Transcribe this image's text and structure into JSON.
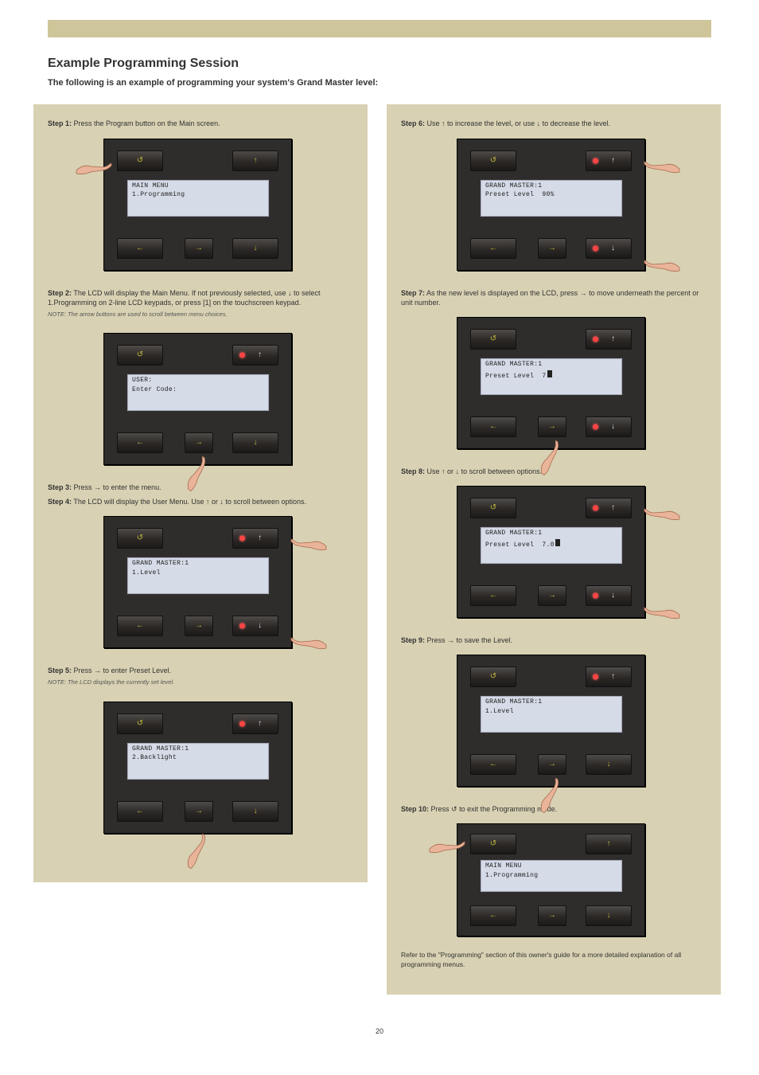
{
  "header": {
    "title": "Example Programming Session",
    "subtitle": "The following is an example of programming your system's Grand Master level:"
  },
  "left": {
    "s1": {
      "lab": "Step 1:",
      "txt": "Press the Program button on the Main screen."
    },
    "p1": {
      "l1": "MAIN MENU",
      "l2": "1.Programming"
    },
    "s2": {
      "lab": "Step 2:",
      "txt": "The LCD will display the Main Menu. If not previously selected, use ↓ to select 1.Programming on 2-line LCD keypads, or press [1] on the touchscreen keypad."
    },
    "n2": "NOTE: The arrow buttons are used to scroll between menu choices.",
    "p2": {
      "l1": "USER:",
      "l2": "Enter Code:"
    },
    "s3": {
      "lab": "Step 3:",
      "txt": "Press → to enter the menu."
    },
    "p3": {
      "l1": "GRAND MASTER:1",
      "l2": "1.Level"
    },
    "s4": {
      "lab": "Step 4:",
      "txt": "The LCD will display the User Menu. Use ↑ or ↓ to scroll between options."
    },
    "p4": {
      "l1": "GRAND MASTER:1",
      "l2": "2.Backlight"
    },
    "s5": {
      "lab": "Step 5:",
      "txt": "Press → to enter Preset Level."
    },
    "n5": "NOTE: The LCD displays the currently set level."
  },
  "right": {
    "s6": {
      "lab": "Step 6:",
      "pre": "Use ",
      "post": " to increase the level, or use ↓ to decrease the level."
    },
    "p6": {
      "l1": "GRAND MASTER:1",
      "l2": "Preset Level  90%"
    },
    "s7": {
      "lab": "Step 7:",
      "txt": "As the new level is displayed on the LCD, press → to move underneath the percent or unit number."
    },
    "p7": {
      "l1": "GRAND MASTER:1",
      "l2": "Preset Level  7"
    },
    "s8": {
      "lab": "Step 8:",
      "pre": "Use ",
      "mid": " or ",
      "post": " to scroll between options."
    },
    "p8": {
      "l1": "GRAND MASTER:1",
      "l2": "Preset Level  7.0"
    },
    "s9": {
      "lab": "Step 9:",
      "txt": "Press → to save the Level."
    },
    "p9": {
      "l1": "GRAND MASTER:1",
      "l2": "1.Level"
    },
    "s10": {
      "lab": "Step 10:",
      "txt": "Press ↺ to exit the Programming mode."
    },
    "p10": {
      "l1": "MAIN MENU",
      "l2": "1.Programming"
    },
    "foot": "Refer to the \"Programming\" section of this owner's guide for a more detailed explanation of all programming menus."
  },
  "glyph": {
    "back": "↺",
    "up": "↑",
    "down": "↓",
    "left": "←",
    "right": "→"
  },
  "page": "20"
}
